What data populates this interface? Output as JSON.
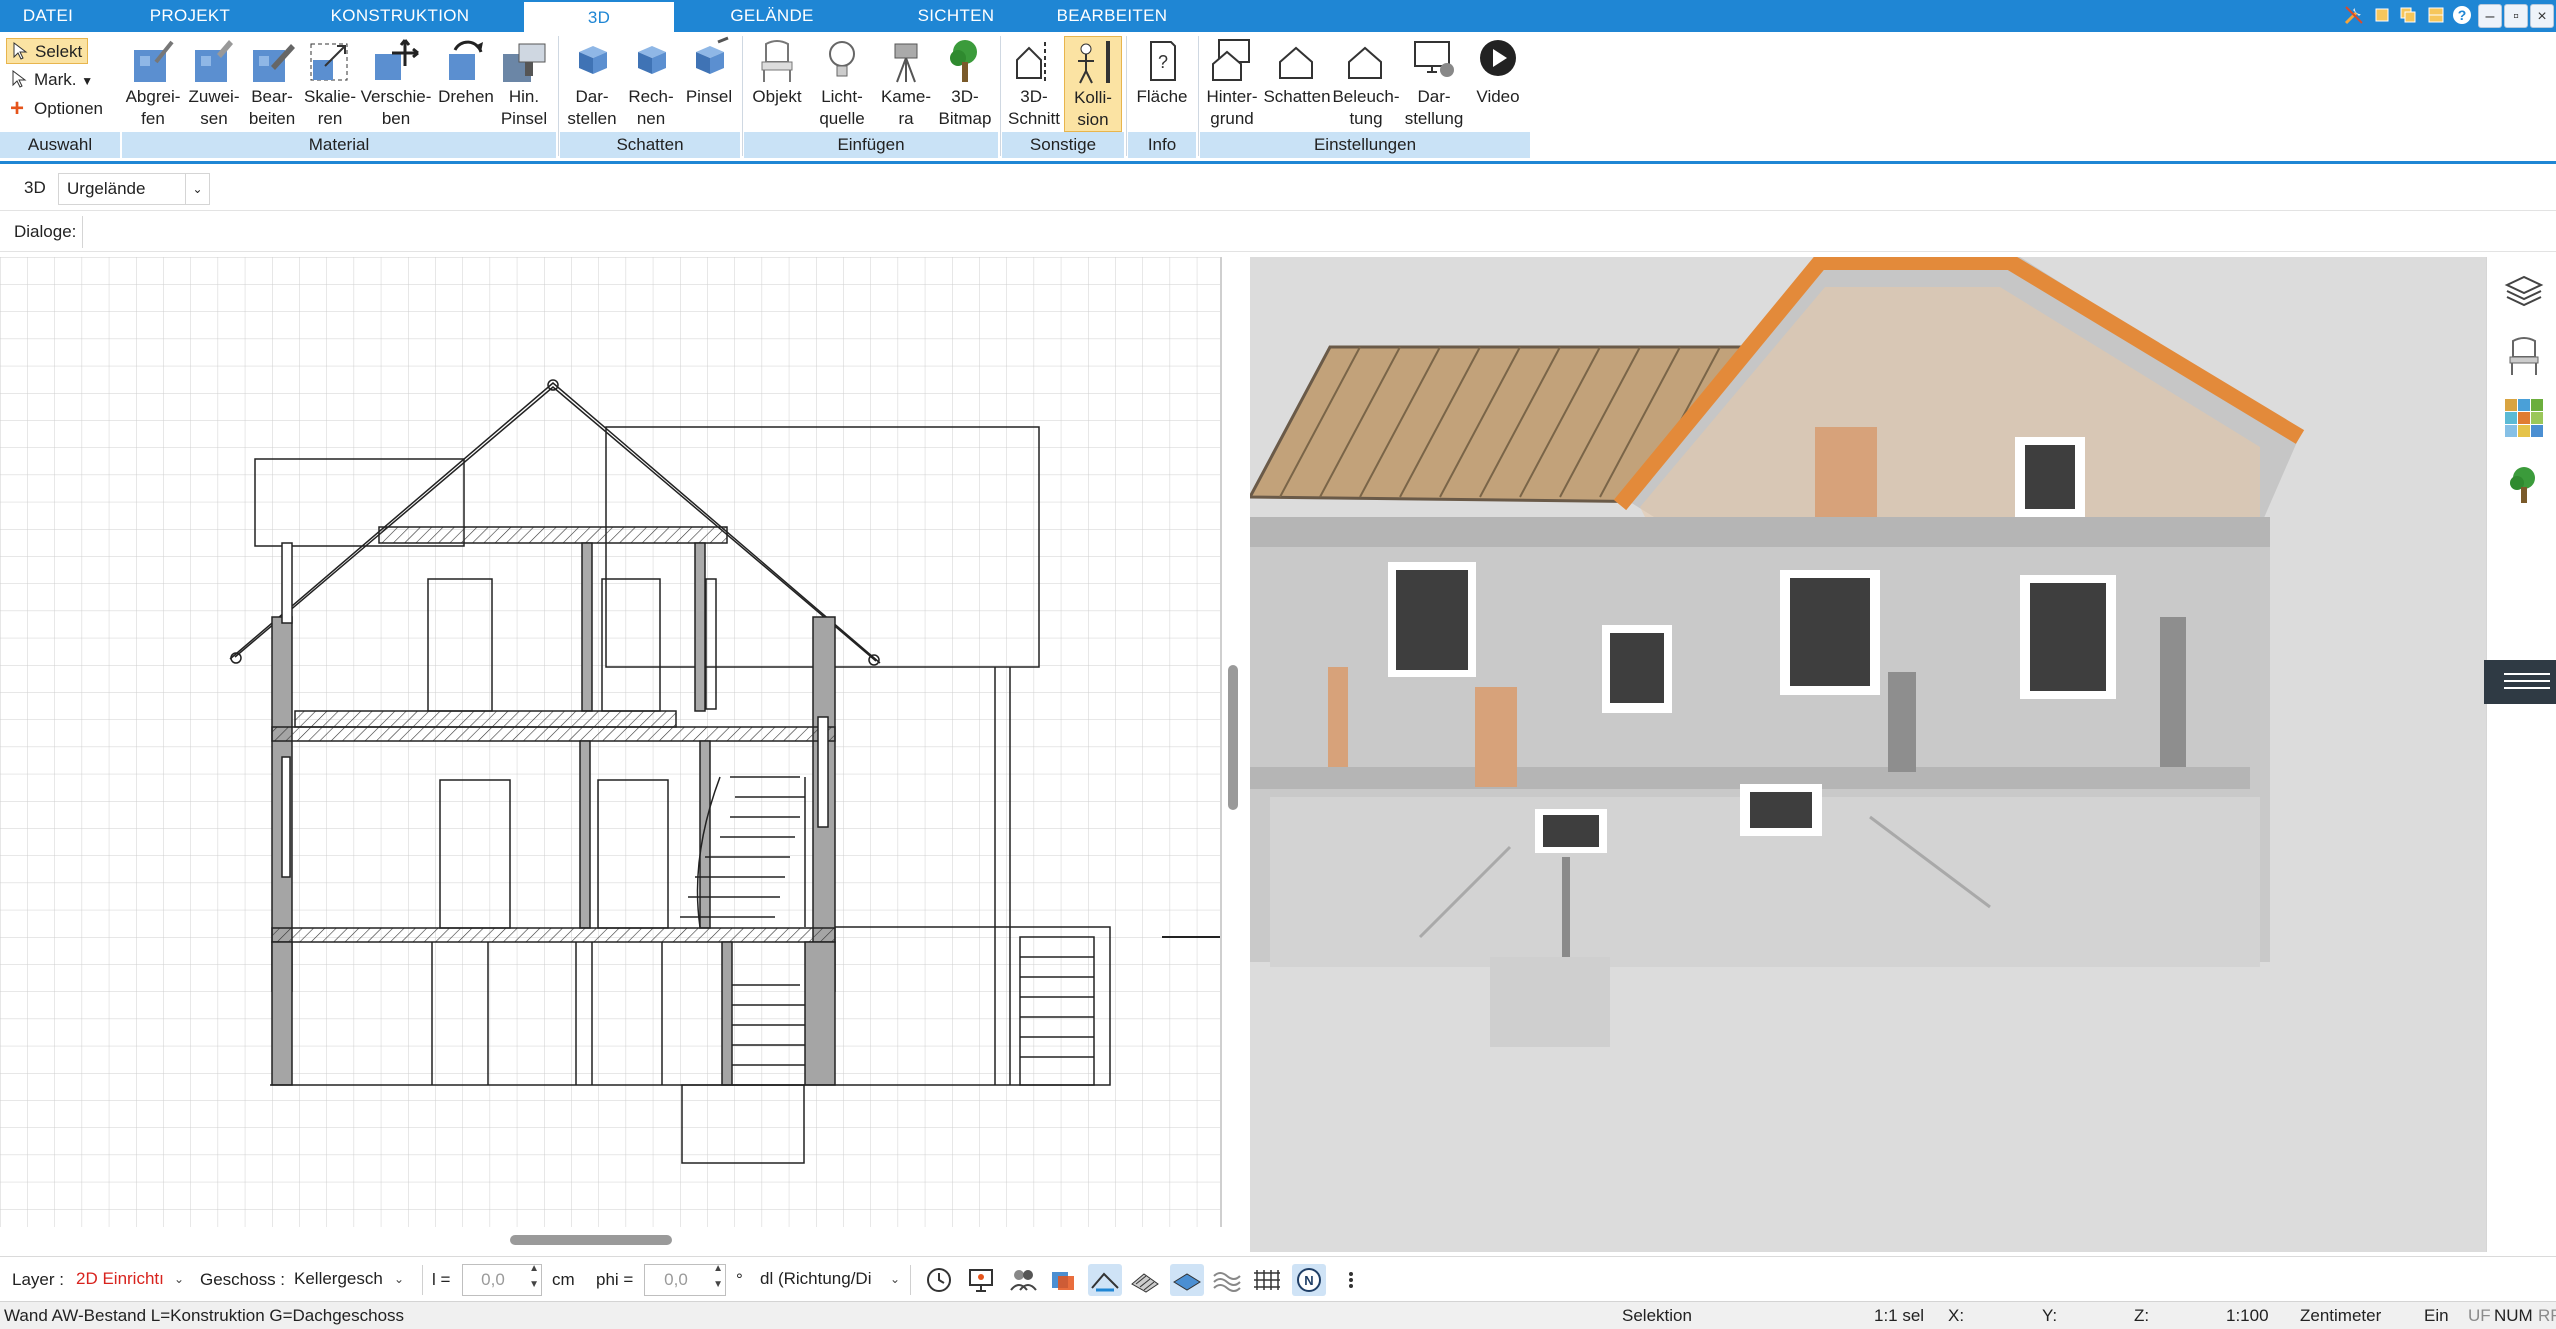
{
  "tabs": [
    {
      "label": "DATEI",
      "active": false
    },
    {
      "label": "PROJEKT",
      "active": false
    },
    {
      "label": "KONSTRUKTION",
      "active": false
    },
    {
      "label": "3D",
      "active": true
    },
    {
      "label": "GELÄNDE",
      "active": false
    },
    {
      "label": "SICHTEN",
      "active": false
    },
    {
      "label": "BEARBEITEN",
      "active": false
    }
  ],
  "selection": {
    "selekt": "Selekt",
    "mark": "Mark.",
    "optionen": "Optionen"
  },
  "ribbon": {
    "material": [
      "Abgrei-\nfen",
      "Zuwei-\nsen",
      "Bear-\nbeiten",
      "Skalie-\nren",
      "Verschie-\nben",
      "Drehen",
      "Hin.\nPinsel"
    ],
    "schatten": [
      "Dar-\nstellen",
      "Rech-\nnen",
      "Pinsel"
    ],
    "einfuegen": [
      "Objekt",
      "Licht-\nquelle",
      "Kame-\nra",
      "3D-\nBitmap"
    ],
    "sonstige": [
      "3D-\nSchnitt",
      "Kolli-\nsion"
    ],
    "info": [
      "Fläche"
    ],
    "einstellungen": [
      "Hinter-\ngrund",
      "Schatten",
      "Beleuch-\ntung",
      "Dar-\nstellung",
      "Video"
    ]
  },
  "groups": {
    "auswahl": "Auswahl",
    "material": "Material",
    "schatten": "Schatten",
    "einfuegen": "Einfügen",
    "sonstige": "Sonstige",
    "info": "Info",
    "einstellungen": "Einstellungen"
  },
  "toolbar": {
    "mode": "3D",
    "terrain": "Urgelände",
    "dialoge": "Dialoge:"
  },
  "propbar": {
    "layer_label": "Layer :",
    "layer_value": "2D Einrichtı",
    "geschoss_label": "Geschoss :",
    "geschoss_value": "Kellergesch",
    "l_label": "l =",
    "l_value": "0,0",
    "l_unit": "cm",
    "phi_label": "phi =",
    "phi_value": "0,0",
    "phi_unit": "°",
    "direction": "dl (Richtung/Di"
  },
  "status": {
    "message": "Wand AW-Bestand L=Konstruktion G=Dachgeschoss",
    "mode": "Selektion",
    "count": "1:1 sel",
    "x": "X:",
    "y": "Y:",
    "z": "Z:",
    "scale": "1:100",
    "unit": "Zentimeter",
    "ein": "Ein",
    "uf": "UF",
    "num": "NUM",
    "rf": "RF"
  },
  "colors": {
    "accent": "#1f86d4",
    "group_bg": "#c9e2f6",
    "active_btn": "#fbe3a3",
    "layer_text": "#d8231e"
  }
}
